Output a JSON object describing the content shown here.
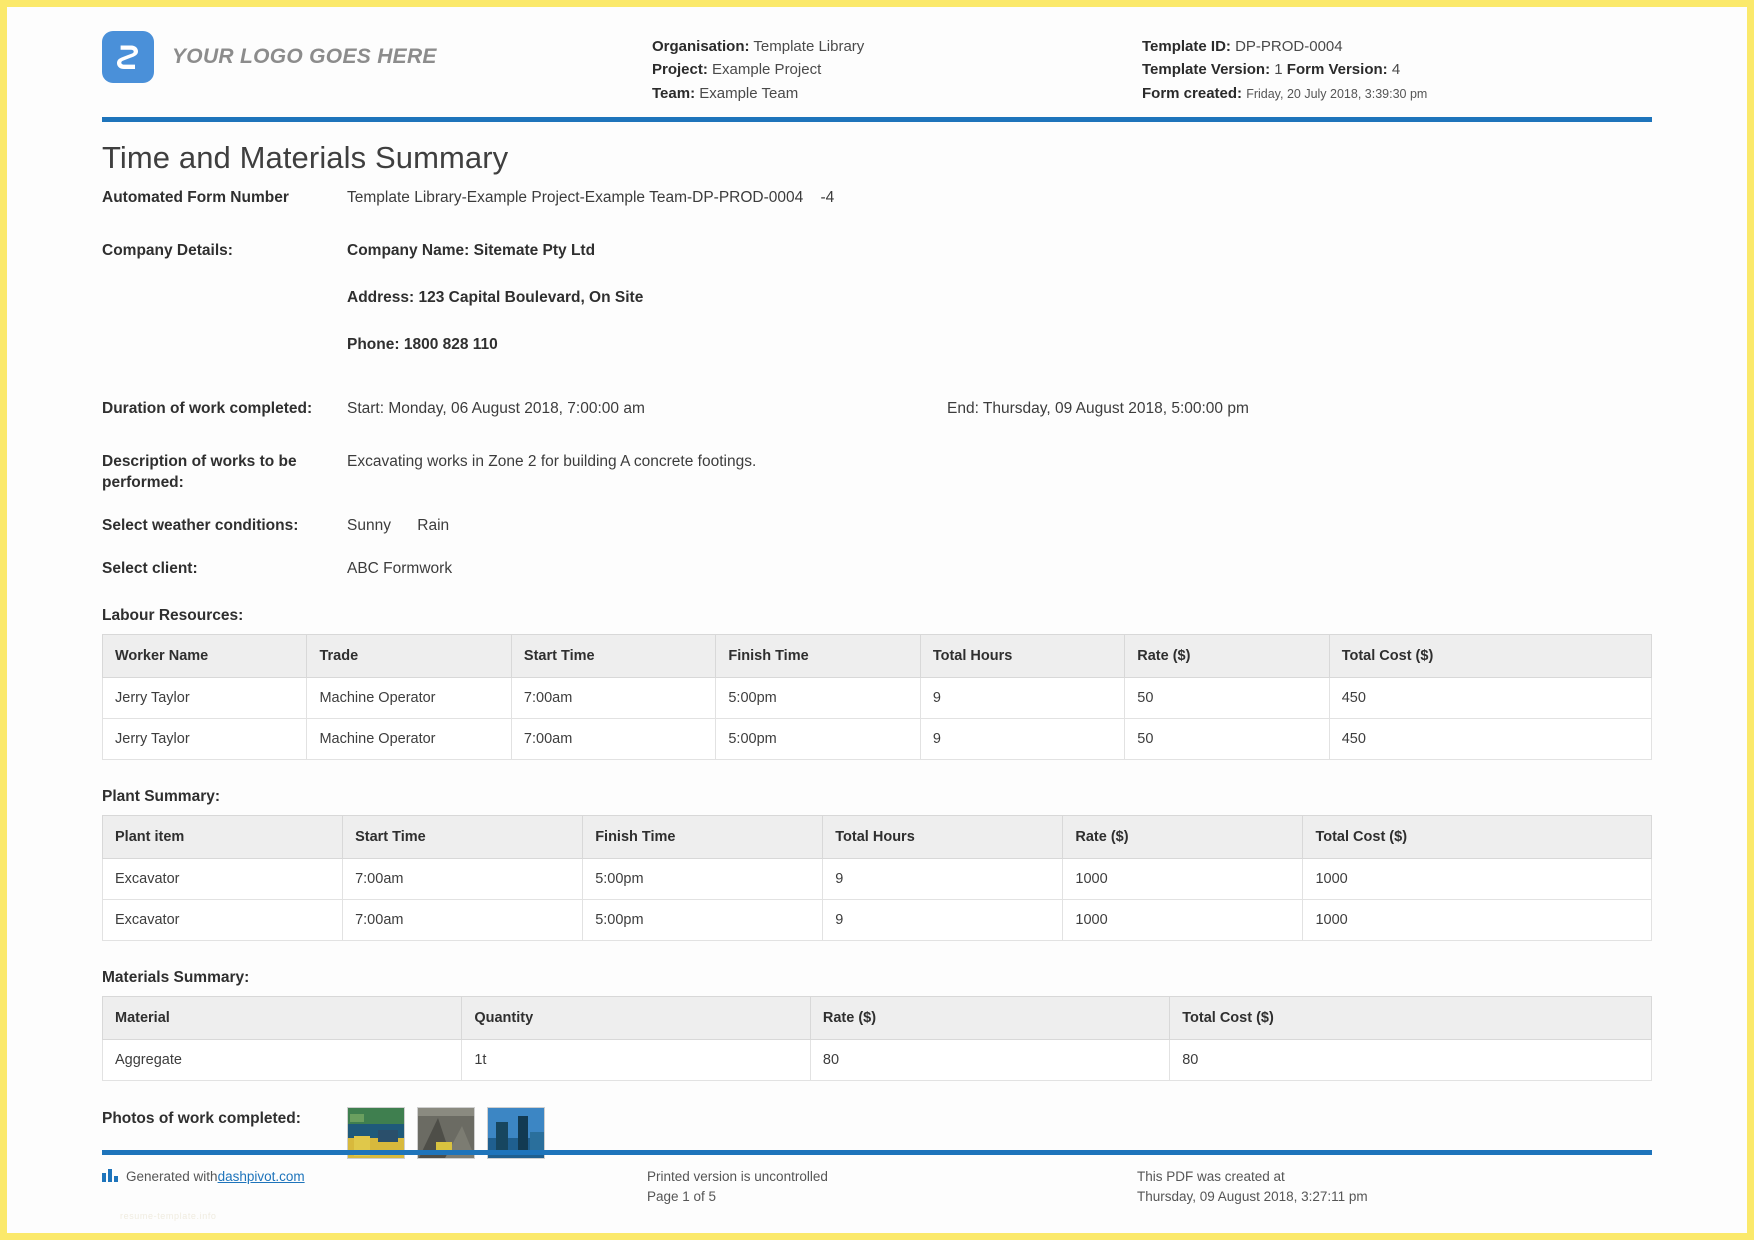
{
  "header": {
    "logo_text": "YOUR LOGO GOES HERE",
    "organisation_label": "Organisation:",
    "organisation_value": "Template Library",
    "project_label": "Project:",
    "project_value": "Example Project",
    "team_label": "Team:",
    "team_value": "Example Team",
    "template_id_label": "Template ID:",
    "template_id_value": "DP-PROD-0004",
    "template_version_label": "Template Version:",
    "template_version_value": "1",
    "form_version_label": "Form Version:",
    "form_version_value": "4",
    "form_created_label": "Form created:",
    "form_created_value": "Friday, 20 July 2018, 3:39:30 pm"
  },
  "title": "Time and Materials Summary",
  "fields": {
    "automated_form_number_label": "Automated Form Number",
    "automated_form_number_value": "Template Library-Example Project-Example Team-DP-PROD-0004",
    "automated_form_number_suffix": "-4",
    "company_details_label": "Company Details:",
    "company_name": "Company Name: Sitemate Pty Ltd",
    "company_address": "Address: 123 Capital Boulevard, On Site",
    "company_phone": "Phone: 1800 828 110",
    "duration_label": "Duration of work completed:",
    "duration_start": "Start: Monday, 06 August 2018, 7:00:00 am",
    "duration_end": "End: Thursday, 09 August 2018, 5:00:00 pm",
    "description_label": "Description of works to be performed:",
    "description_value": "Excavating works in Zone 2 for building A concrete footings.",
    "weather_label": "Select weather conditions:",
    "weather_values": [
      "Sunny",
      "Rain"
    ],
    "client_label": "Select client:",
    "client_value": "ABC Formwork",
    "photos_label": "Photos of work completed:"
  },
  "labour": {
    "heading": "Labour Resources:",
    "columns": [
      "Worker Name",
      "Trade",
      "Start Time",
      "Finish Time",
      "Total Hours",
      "Rate ($)",
      "Total Cost ($)"
    ],
    "rows": [
      [
        "Jerry Taylor",
        "Machine Operator",
        "7:00am",
        "5:00pm",
        "9",
        "50",
        "450"
      ],
      [
        "Jerry Taylor",
        "Machine Operator",
        "7:00am",
        "5:00pm",
        "9",
        "50",
        "450"
      ]
    ]
  },
  "plant": {
    "heading": "Plant Summary:",
    "columns": [
      "Plant item",
      "Start Time",
      "Finish Time",
      "Total Hours",
      "Rate ($)",
      "Total Cost ($)"
    ],
    "rows": [
      [
        "Excavator",
        "7:00am",
        "5:00pm",
        "9",
        "1000",
        "1000"
      ],
      [
        "Excavator",
        "7:00am",
        "5:00pm",
        "9",
        "1000",
        "1000"
      ]
    ]
  },
  "materials": {
    "heading": "Materials Summary:",
    "columns": [
      "Material",
      "Quantity",
      "Rate ($)",
      "Total Cost ($)"
    ],
    "rows": [
      [
        "Aggregate",
        "1t",
        "80",
        "80"
      ]
    ]
  },
  "footer": {
    "generated_prefix": "Generated with ",
    "generated_link": "dashpivot.com",
    "printed_line1": "Printed version is uncontrolled",
    "printed_line2": "Page 1 of 5",
    "created_line1": "This PDF was created at",
    "created_line2": "Thursday, 09 August 2018, 3:27:11 pm",
    "watermark": "resume-template.info"
  },
  "colors": {
    "brand_blue": "#1e74bb",
    "logo_blue": "#4a90d9",
    "frame_yellow": "#fbe96b"
  }
}
